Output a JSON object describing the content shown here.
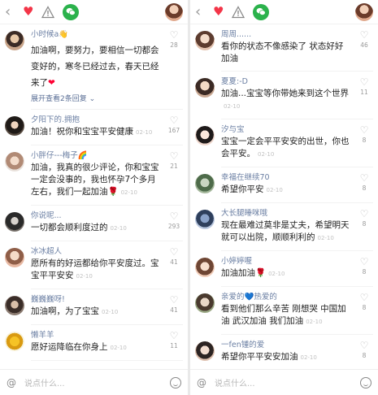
{
  "colors": {
    "accent": "#f33548",
    "wechat": "#2bb24c",
    "name": "#6b7fa3"
  },
  "icons": {
    "back": "chevron-left",
    "like": "heart",
    "report": "warning-triangle",
    "share": "wechat",
    "at": "at-sign",
    "emoji": "smiley"
  },
  "left": {
    "comments": [
      {
        "name": "小时候a👋",
        "text": "加油啊，要努力，要相信一切都会变好的，寒冬已经过去，春天已经来了",
        "time": "",
        "likes": "28",
        "expand": "展开查看2条回复"
      },
      {
        "name": "夕阳下的.拥抱",
        "text": "加油！祝你和宝宝平安健康",
        "time": "02-10",
        "likes": "167"
      },
      {
        "name": "小胖仔---梅子🌈",
        "text": "加油，我真的很少评论，你和宝宝一定会没事的，我也怀孕7个多月左右，我们一起加油🌹",
        "time": "02-10",
        "likes": "21"
      },
      {
        "name": "你说呢...",
        "text": "一切都会顺利度过的",
        "time": "02-10",
        "likes": "293"
      },
      {
        "name": "冰冰超人",
        "text": "愿所有的好运都给你平安度过。宝宝平平安安",
        "time": "02-10",
        "likes": "41"
      },
      {
        "name": "巍巍巍呀!",
        "text": "加油啊，为了宝宝",
        "time": "02-10",
        "likes": "41"
      },
      {
        "name": "懒羊羊",
        "text": "愿好运降临在你身上",
        "time": "02-10",
        "likes": "11"
      }
    ],
    "input_placeholder": "说点什么..."
  },
  "right": {
    "comments": [
      {
        "name": "周周......",
        "text": "看你的状态不像感染了 状态好好 加油",
        "time": "",
        "likes": "46"
      },
      {
        "name": "夏夏:-D",
        "text": "加油...宝宝等你带她来到这个世界",
        "time": "02-10",
        "likes": "11"
      },
      {
        "name": "汐与宝",
        "text": "宝宝一定会平平安安的出世，你也会平安。",
        "time": "02-10",
        "likes": "8"
      },
      {
        "name": "幸福在继续70",
        "text": "希望你平安",
        "time": "02-10",
        "likes": "8"
      },
      {
        "name": "大长腿睡咪哦",
        "text": "现在最难过莫非是丈夫，希望明天就可以出院，顺顺利利的",
        "time": "02-10",
        "likes": "8"
      },
      {
        "name": "小婷婷喔",
        "text": "加油加油🌹",
        "time": "02-10",
        "likes": "8"
      },
      {
        "name": "亲爱的💙热爱的",
        "text": "看到他们那么辛苦 刚想哭 中国加油 武汉加油 我们加油",
        "time": "02-10",
        "likes": "8"
      },
      {
        "name": "一fen锺的爱",
        "text": "希望你平平安安加油",
        "time": "02-10",
        "likes": "8"
      }
    ],
    "input_placeholder": "说点什么..."
  }
}
